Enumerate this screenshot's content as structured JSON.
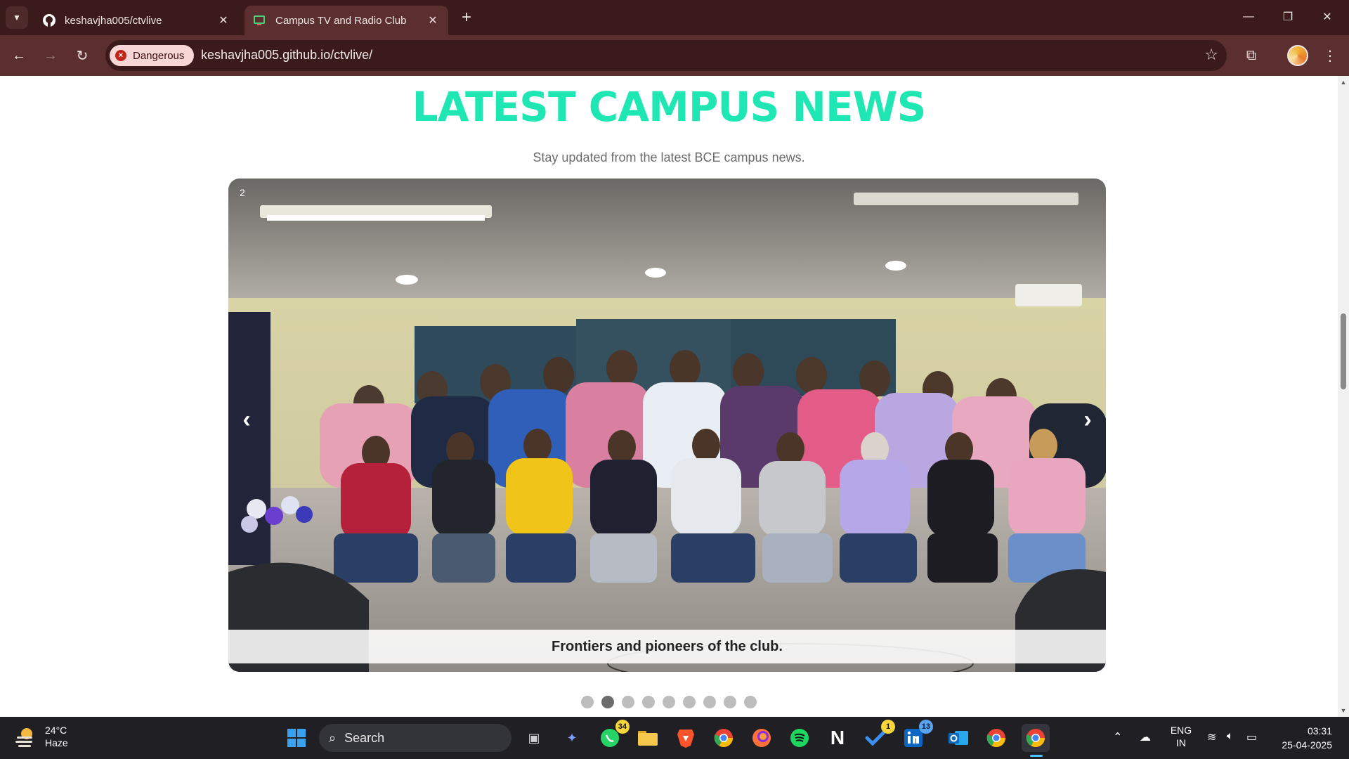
{
  "browser": {
    "tabs": [
      {
        "title": "keshavjha005/ctvlive",
        "favicon": "github-icon"
      },
      {
        "title": "Campus TV and Radio Club",
        "favicon": "tv-icon"
      }
    ],
    "security_chip": "Dangerous",
    "url": "keshavjha005.github.io/ctvlive/"
  },
  "page": {
    "title": "LATEST CAMPUS NEWS",
    "subtitle": "Stay updated from the latest BCE campus news.",
    "slide_number": "2",
    "caption": "Frontiers and pioneers of the club.",
    "prev_arrow": "‹",
    "next_arrow": "›",
    "dots_total": 9,
    "dots_active_index": 1
  },
  "taskbar": {
    "weather_temp": "24°C",
    "weather_desc": "Haze",
    "search_label": "Search",
    "whatsapp_badge": "34",
    "todo_badge": "1",
    "linkedin_badge": "13",
    "lang_top": "ENG",
    "lang_bottom": "IN",
    "time": "03:31",
    "date": "25-04-2025"
  },
  "colors": {
    "accent_title": "#1fe7b4",
    "chrome_dark": "#3a1a1a",
    "chrome_toolbar": "#5b2f2f",
    "danger": "#c2261b"
  }
}
